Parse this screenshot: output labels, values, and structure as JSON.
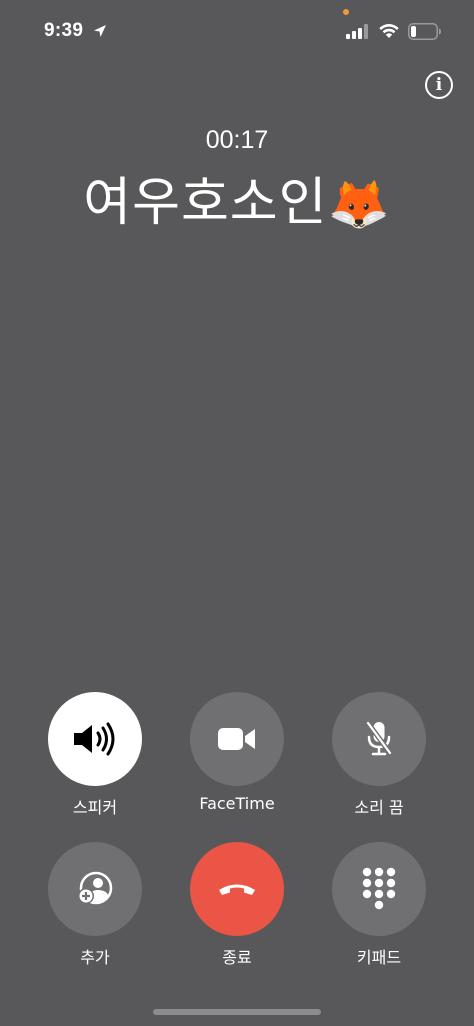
{
  "status_bar": {
    "time": "9:39"
  },
  "call": {
    "duration": "00:17",
    "caller_name": "여우호소인",
    "caller_emoji": "🦊"
  },
  "controls": {
    "speaker": {
      "label": "스피커",
      "active": true,
      "icon": "speaker-icon"
    },
    "facetime": {
      "label": "FaceTime",
      "icon": "video-camera-icon"
    },
    "mute": {
      "label": "소리 끔",
      "icon": "microphone-slash-icon"
    },
    "add_call": {
      "label": "추가",
      "icon": "add-person-icon"
    },
    "end_call": {
      "label": "종료",
      "icon": "phone-down-icon"
    },
    "keypad": {
      "label": "키패드",
      "icon": "keypad-icon"
    }
  },
  "colors": {
    "background": "#58585a",
    "button": "#707072",
    "end_call": "#eb5545",
    "privacy_dot": "#f29a36"
  }
}
